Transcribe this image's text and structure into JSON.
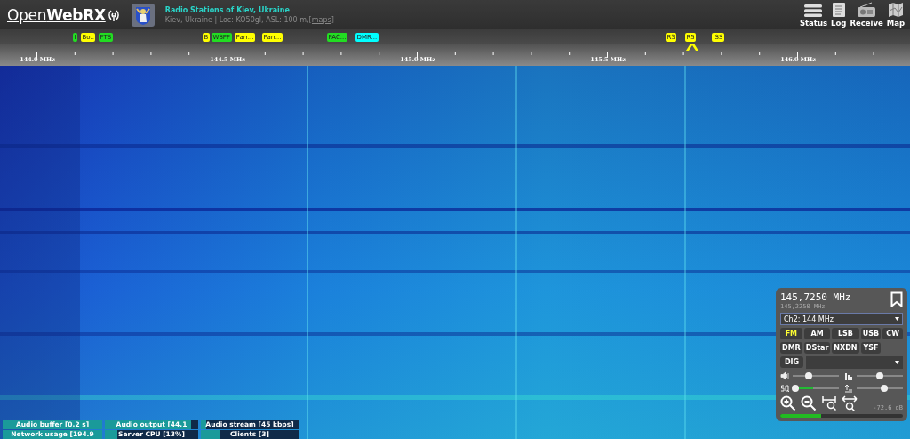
{
  "header": {
    "logo": "Open",
    "logo_bold": "WebRX",
    "title": "Radio Stations of Kiev, Ukraine",
    "subtitle": "Kiev, Ukraine | Loc: KO50gl, ASL: 100 m, ",
    "maps_link": "[maps]",
    "buttons": [
      {
        "kind": "status",
        "label": "Status"
      },
      {
        "kind": "log",
        "label": "Log"
      },
      {
        "kind": "receiver",
        "label": "Receive"
      },
      {
        "kind": "map",
        "label": "Map"
      }
    ]
  },
  "bookmarks": [
    {
      "label": "I",
      "color": "#22dd22"
    },
    {
      "label": "Bo..",
      "color": "#ffff00"
    },
    {
      "label": "FT8",
      "color": "#22dd22"
    },
    {
      "label": "B",
      "color": "#ffff00"
    },
    {
      "label": "WSPF",
      "color": "#22dd22"
    },
    {
      "label": "Parr...",
      "color": "#ffff00"
    },
    {
      "label": "Parr...",
      "color": "#ffff00"
    },
    {
      "label": "PAC...",
      "color": "#22dd22"
    },
    {
      "label": "DMR...",
      "color": "#00ffff"
    },
    {
      "label": "R3",
      "color": "#ffff00"
    },
    {
      "label": "R5",
      "color": "#ffff00"
    },
    {
      "label": "ISS",
      "color": "#ffff00"
    }
  ],
  "scale": {
    "labels": [
      "144.0 MHz",
      "144.5 MHz",
      "145.0 MHz",
      "145.5 MHz",
      "146.0 MHz"
    ]
  },
  "panel": {
    "frequency": "145,7250 MHz",
    "offset_frequency": "145,2250 MHz",
    "profile": "Ch2: 144 MHz",
    "modes": [
      {
        "label": "FM",
        "selected": true
      },
      {
        "label": "AM",
        "selected": false
      },
      {
        "label": "LSB",
        "selected": false
      },
      {
        "label": "USB",
        "selected": false
      },
      {
        "label": "CW",
        "selected": false
      },
      {
        "label": "DMR",
        "selected": false
      },
      {
        "label": "DStar",
        "selected": false
      },
      {
        "label": "NXDN",
        "selected": false
      },
      {
        "label": "YSF",
        "selected": false
      }
    ],
    "dig_button": "DIG",
    "sliders": [
      {
        "kind": "volume",
        "level": 0.35
      },
      {
        "kind": "noise",
        "level": 0.5
      },
      {
        "kind": "squelch",
        "level": 0.05,
        "meter": {
          "level": 0.45
        }
      },
      {
        "kind": "gain",
        "level": 0.6
      }
    ],
    "smeter": {
      "reading": "-72.6 dB",
      "level": 0.33
    }
  },
  "status_bars": [
    {
      "label": "Audio buffer [0.2 s]",
      "level": 1.0
    },
    {
      "label": "Audio output [44.1",
      "level": 0.92
    },
    {
      "label": "Audio stream [45 kbps]",
      "level": 0.05
    },
    {
      "label": "Network usage [194.9",
      "level": 1.0
    },
    {
      "label": "Server CPU [13%]",
      "level": 0.13
    },
    {
      "label": "Clients [3]",
      "level": 0.2
    }
  ]
}
